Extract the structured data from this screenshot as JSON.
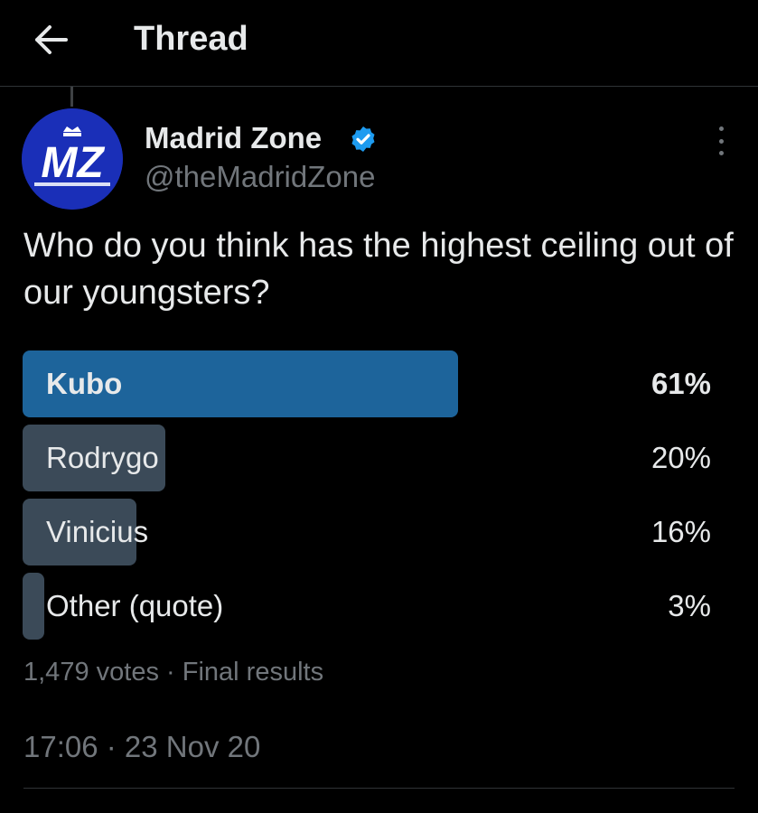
{
  "header": {
    "title": "Thread",
    "back_icon": "arrow-left-icon"
  },
  "tweet": {
    "author_name": "Madrid Zone",
    "handle": "@theMadridZone",
    "avatar_text": "MZ",
    "verified_icon": "verified-badge-icon",
    "more_icon": "more-vertical-icon",
    "text": "Who do you think has the highest ceiling out of our youngsters?",
    "timestamp": "17:06 · 23 Nov 20"
  },
  "poll": {
    "options": [
      {
        "label": "Kubo",
        "percent_label": "61%",
        "percent": 61,
        "winner": true
      },
      {
        "label": "Rodrygo",
        "percent_label": "20%",
        "percent": 20,
        "winner": false
      },
      {
        "label": "Vinicius",
        "percent_label": "16%",
        "percent": 16,
        "winner": false
      },
      {
        "label": "Other (quote)",
        "percent_label": "3%",
        "percent": 3,
        "winner": false
      }
    ],
    "votes": "1,479 votes",
    "separator": "·",
    "status": "Final results"
  },
  "colors": {
    "background": "#000000",
    "winner_bar": "#1d649b",
    "other_bar": "#3b4a58",
    "verified": "#1d9bf0",
    "secondary_text": "#71767b",
    "avatar_bg": "#1a2fb8"
  }
}
